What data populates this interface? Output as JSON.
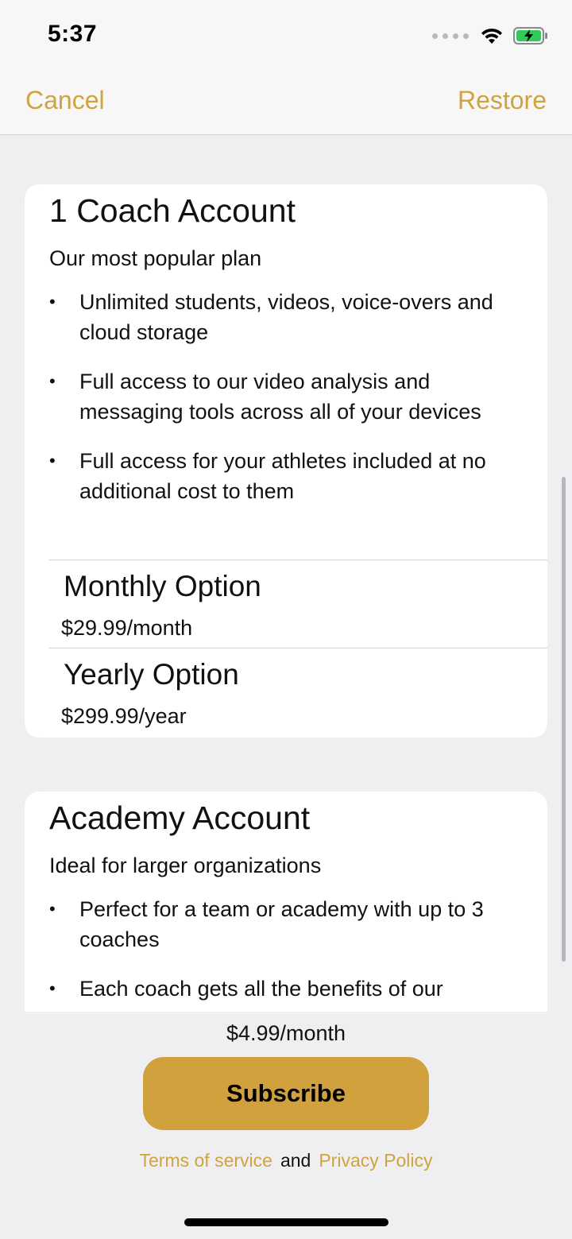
{
  "status": {
    "time": "5:37"
  },
  "nav": {
    "cancel_label": "Cancel",
    "restore_label": "Restore"
  },
  "plans": [
    {
      "title": "1 Coach Account",
      "subtitle": "Our most popular plan",
      "features": [
        "Unlimited students, videos, voice-overs and cloud storage",
        "Full access to our video analysis and messaging tools across all of your devices",
        "Full access for your athletes included at no additional cost to them"
      ],
      "options": [
        {
          "title": "Monthly Option",
          "price": "$29.99/month"
        },
        {
          "title": "Yearly Option",
          "price": "$299.99/year"
        }
      ]
    },
    {
      "title": "Academy Account",
      "subtitle": "Ideal for larger organizations",
      "features": [
        "Perfect for a team or academy with up to 3 coaches",
        "Each coach gets all the benefits of our"
      ]
    }
  ],
  "footer": {
    "price": "$4.99/month",
    "subscribe_label": "Subscribe",
    "terms_label": "Terms of service",
    "and_label": "and",
    "privacy_label": "Privacy Policy"
  },
  "colors": {
    "accent": "#cfa33f",
    "button": "#d0a13c",
    "background": "#efeff2"
  },
  "icons": [
    "cellular-dots-icon",
    "wifi-icon",
    "battery-charging-icon"
  ]
}
